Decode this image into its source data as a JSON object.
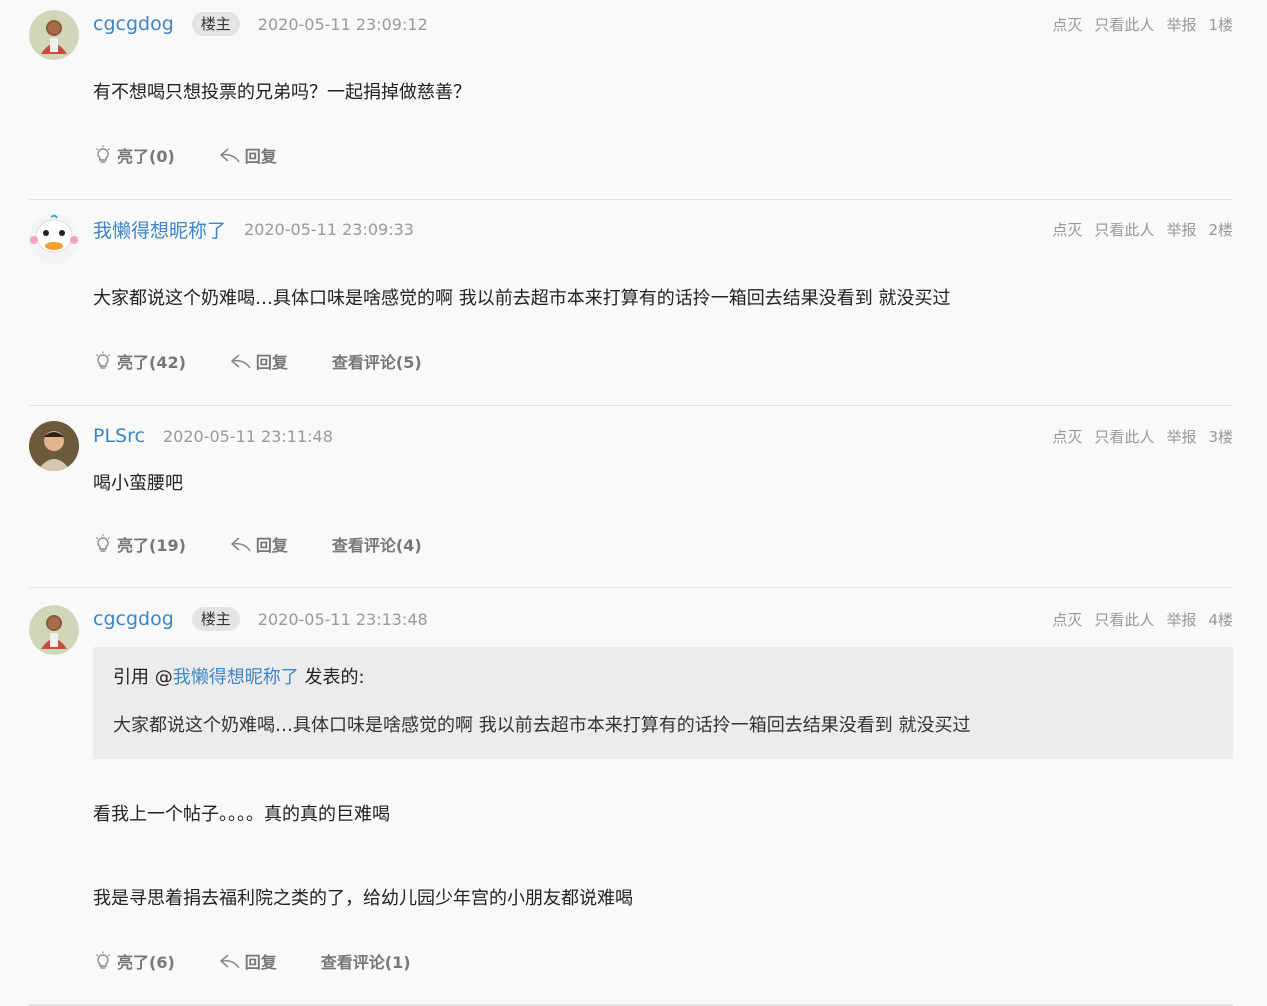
{
  "actions": {
    "bury": "点灭",
    "only_author": "只看此人",
    "report": "举报"
  },
  "reply_label": "回复",
  "posts": [
    {
      "username": "cgcgdog",
      "op_badge": "楼主",
      "timestamp": "2020-05-11 23:09:12",
      "floor": "1楼",
      "content": [
        "有不想喝只想投票的兄弟吗？一起捐掉做慈善？"
      ],
      "light_label": "亮了(0)"
    },
    {
      "username": "我懒得想昵称了",
      "timestamp": "2020-05-11 23:09:33",
      "floor": "2楼",
      "content": [
        "大家都说这个奶难喝…具体口味是啥感觉的啊 我以前去超市本来打算有的话拎一箱回去结果没看到 就没买过"
      ],
      "light_label": "亮了(42)",
      "comments_label": "查看评论(5)"
    },
    {
      "username": "PLSrc",
      "timestamp": "2020-05-11 23:11:48",
      "floor": "3楼",
      "content": [
        "喝小蛮腰吧"
      ],
      "light_label": "亮了(19)",
      "comments_label": "查看评论(4)"
    },
    {
      "username": "cgcgdog",
      "op_badge": "楼主",
      "timestamp": "2020-05-11 23:13:48",
      "floor": "4楼",
      "quote": {
        "prefix": "引用 @",
        "user": "我懒得想昵称了",
        "suffix": " 发表的:",
        "text": "大家都说这个奶难喝…具体口味是啥感觉的啊 我以前去超市本来打算有的话拎一箱回去结果没看到 就没买过"
      },
      "content": [
        "看我上一个帖子。。。。真的真的巨难喝",
        "我是寻思着捐去福利院之类的了，给幼儿园少年宫的小朋友都说难喝"
      ],
      "light_label": "亮了(6)",
      "comments_label": "查看评论(1)"
    }
  ],
  "icons": {
    "light": "lightbulb-icon",
    "reply": "reply-arrow-icon"
  },
  "colors": {
    "username": "#3d85c6",
    "background": "#f9f9f9",
    "quote_bg": "#ececec"
  }
}
